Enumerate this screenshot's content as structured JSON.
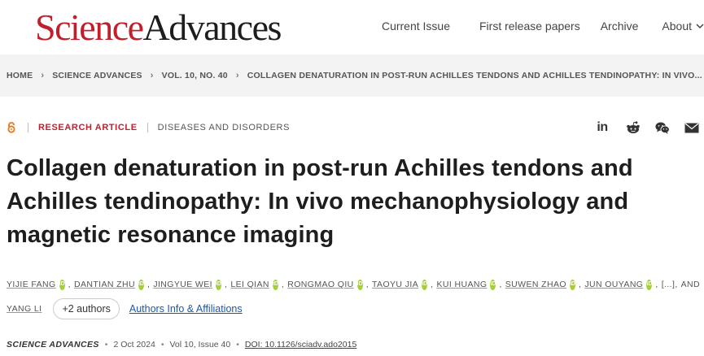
{
  "header": {
    "logo_part1": "Science",
    "logo_part2": "Advances",
    "nav": [
      {
        "label": "Current Issue"
      },
      {
        "label": "First release papers"
      },
      {
        "label": "Archive"
      },
      {
        "label": "About"
      }
    ]
  },
  "breadcrumb": [
    "HOME",
    "SCIENCE ADVANCES",
    "VOL. 10, NO. 40",
    "COLLAGEN DENATURATION IN POST-RUN ACHILLES TENDONS AND ACHILLES TENDINOPATHY: IN VIVO..."
  ],
  "article": {
    "type": "RESEARCH ARTICLE",
    "subject": "DISEASES AND DISORDERS",
    "title": "Collagen denaturation in post-run Achilles tendons and Achilles tendinopathy: In vivo mechanophysiology and magnetic resonance imaging",
    "authors": [
      "YIJIE FANG",
      "DANTIAN ZHU",
      "JINGYUE WEI",
      "LEI QIAN",
      "RONGMAO QIU",
      "TAOYU JIA",
      "KUI HUANG",
      "SUWEN ZHAO",
      "JUN OUYANG"
    ],
    "orcid_label": "iD",
    "ellipsis": "[...]",
    "and_label": "AND",
    "last_author": "YANG LI",
    "more_authors_label": "+2 authors",
    "affiliations_label": "Authors Info & Affiliations"
  },
  "citation": {
    "journal": "SCIENCE ADVANCES",
    "date": "2 Oct 2024",
    "volume": "Vol 10, Issue 40",
    "doi": "DOI: 10.1126/sciadv.ado2015"
  },
  "share_icons": [
    "linkedin-icon",
    "reddit-icon",
    "wechat-icon",
    "email-icon"
  ],
  "colors": {
    "brand_red": "#c21f2c",
    "orcid_green": "#a6ce39",
    "link_blue": "#1a58a8",
    "breadcrumb_bg": "#f3f3f3"
  }
}
